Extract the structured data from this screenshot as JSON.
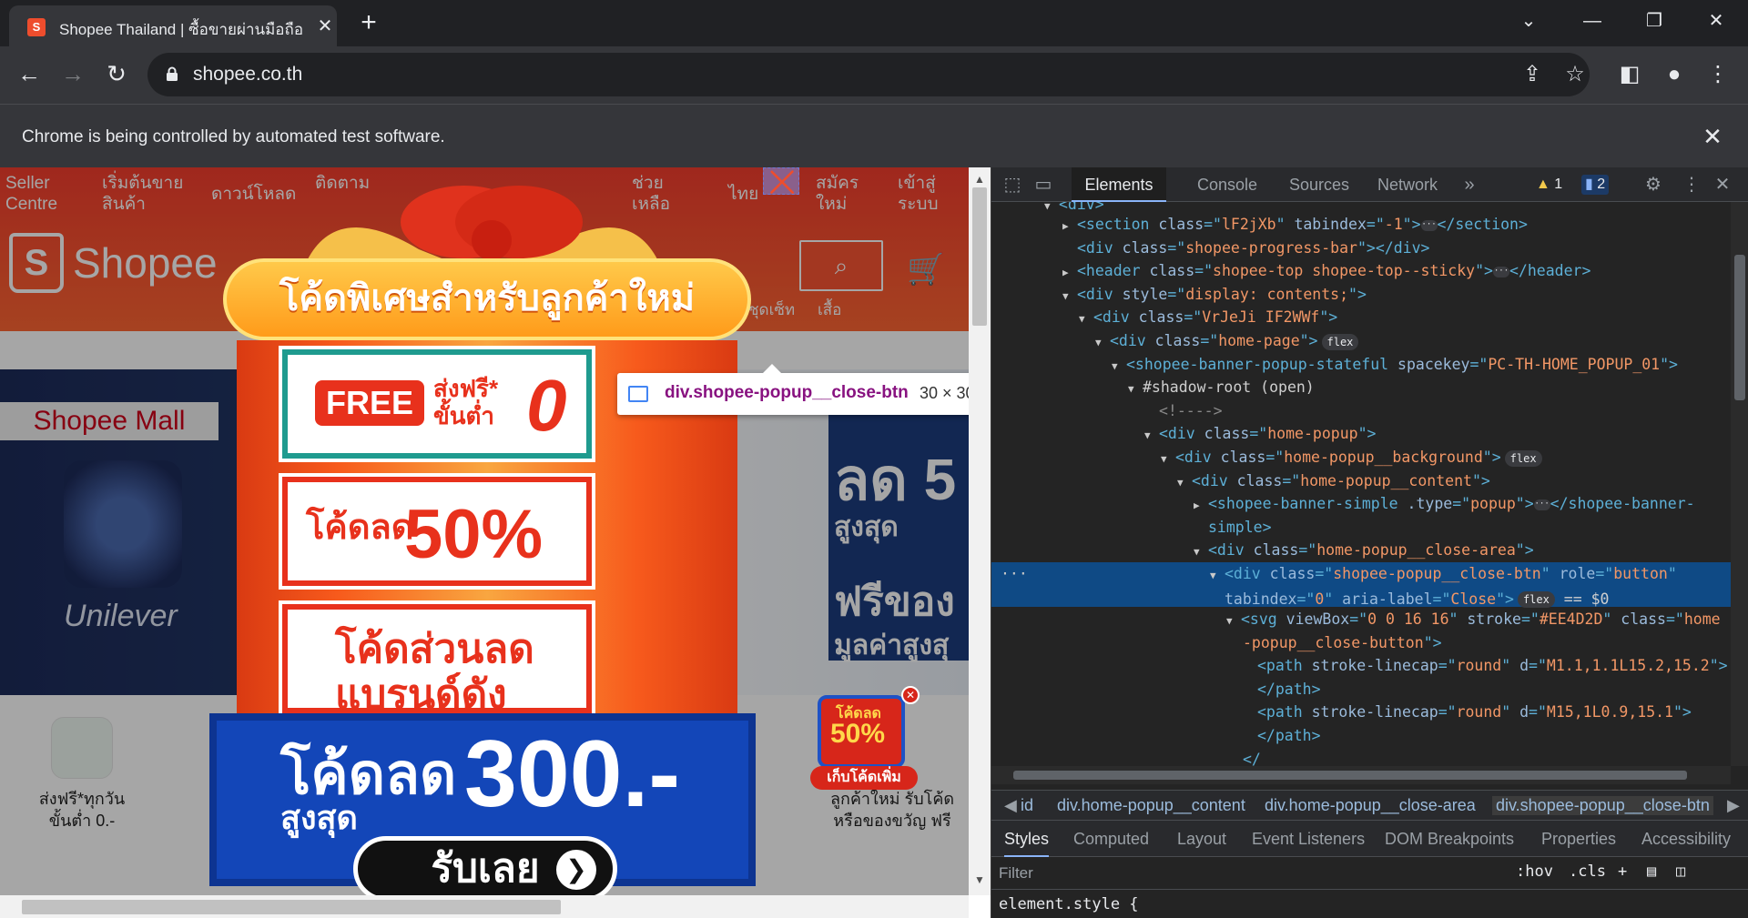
{
  "browser": {
    "tab_title": "Shopee Thailand | ซื้อขายผ่านมือถือ",
    "favicon": "shopee-bag-icon",
    "url": "shopee.co.th",
    "infobar_message": "Chrome is being controlled by automated test software."
  },
  "shopee": {
    "nav": [
      "Seller Centre",
      "เริ่มต้นขาย สินค้า",
      "ดาวน์โหลด",
      "ติดตาม",
      "ช่วย เหลือ",
      "ไทย",
      "สมัคร ใหม่",
      "เข้าสู่ ระบบ"
    ],
    "logo_text": "Shopee",
    "keywords": [
      "ชุดเซ็ท",
      "เสื้อ"
    ],
    "mall_label": "Shopee Mall",
    "brand": "Unilever",
    "promo_right": [
      "ลด 5",
      "สูงสุด",
      "ฟรีของ",
      "มูลค่าสูงสุ"
    ],
    "quick_links": [
      {
        "line1": "ส่งฟรี*ทุกวัน",
        "line2": "ขั้นต่ำ 0.-"
      },
      {
        "line1": "ลูกค้าใหม่ รับโค้ด",
        "line2": "หรือของขวัญ ฟรี"
      }
    ]
  },
  "popup": {
    "header": "โค้ดพิเศษสำหรับลูกค้าใหม่",
    "coupon1_free": "FREE",
    "coupon1_text": "ส่งฟรี* ขั้นต่ำ",
    "coupon1_zero": "0",
    "coupon2_text": "โค้ดลด",
    "coupon2_value": "50%",
    "coupon3_line1": "โค้ดส่วนลด",
    "coupon3_line2": "แบรนด์ดัง",
    "base_line1": "โค้ดลด",
    "base_line2": "สูงสุด",
    "base_value": "300.-",
    "claim_button": "รับเลย",
    "float_badge_top": "โค้ดลด",
    "float_badge_value": "50%",
    "float_badge_cta": "เก็บโค้ดเพิ่ม"
  },
  "inspector_tooltip": {
    "selector": "div.shopee-popup__close-btn",
    "size": "30 × 30"
  },
  "devtools": {
    "tabs": [
      "Elements",
      "Console",
      "Sources",
      "Network"
    ],
    "warnings": "1",
    "messages": "2",
    "breadcrumbs": [
      "id",
      "div.home-popup__content",
      "div.home-popup__close-area",
      "div.shopee-popup__close-btn"
    ],
    "style_tabs": [
      "Styles",
      "Computed",
      "Layout",
      "Event Listeners",
      "DOM Breakpoints",
      "Properties",
      "Accessibility"
    ],
    "filter_placeholder": "Filter",
    "hov": ":hov",
    "cls": ".cls",
    "element_style": "element.style {"
  }
}
